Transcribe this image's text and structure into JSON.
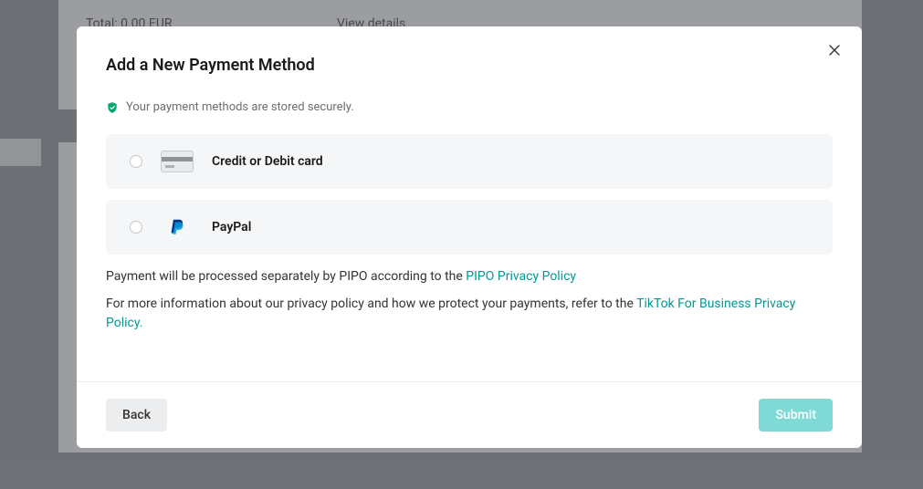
{
  "background": {
    "total_label": "Total: 0.00 EUR",
    "view_details": "View details"
  },
  "modal": {
    "title": "Add a New Payment Method",
    "secure_text": "Your payment methods are stored securely.",
    "options": [
      {
        "label": "Credit or Debit card"
      },
      {
        "label": "PayPal"
      }
    ],
    "info1_prefix": "Payment will be processed separately by PIPO according to the ",
    "info1_link": "PIPO Privacy Policy",
    "info2_prefix": "For more information about our privacy policy and how we protect your payments, refer to the ",
    "info2_link": "TikTok For Business Privacy Policy.",
    "back": "Back",
    "submit": "Submit"
  }
}
